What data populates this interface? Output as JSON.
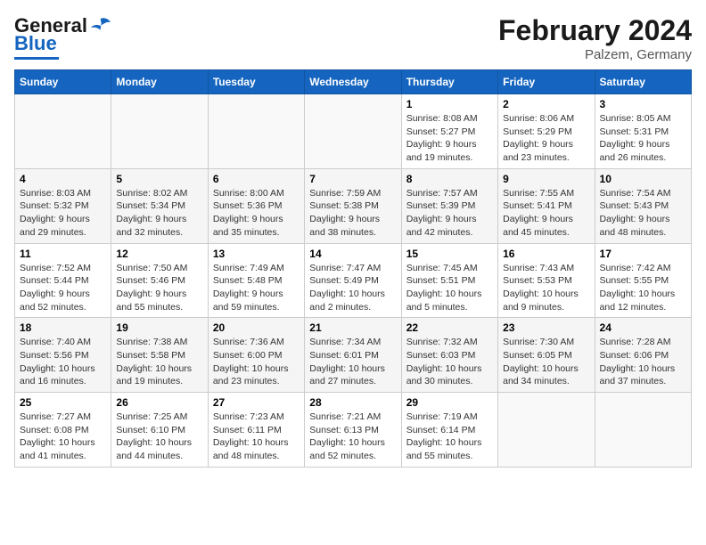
{
  "header": {
    "logo_general": "General",
    "logo_blue": "Blue",
    "month": "February 2024",
    "location": "Palzem, Germany"
  },
  "days_of_week": [
    "Sunday",
    "Monday",
    "Tuesday",
    "Wednesday",
    "Thursday",
    "Friday",
    "Saturday"
  ],
  "weeks": [
    [
      {
        "day": "",
        "info": ""
      },
      {
        "day": "",
        "info": ""
      },
      {
        "day": "",
        "info": ""
      },
      {
        "day": "",
        "info": ""
      },
      {
        "day": "1",
        "info": "Sunrise: 8:08 AM\nSunset: 5:27 PM\nDaylight: 9 hours and 19 minutes."
      },
      {
        "day": "2",
        "info": "Sunrise: 8:06 AM\nSunset: 5:29 PM\nDaylight: 9 hours and 23 minutes."
      },
      {
        "day": "3",
        "info": "Sunrise: 8:05 AM\nSunset: 5:31 PM\nDaylight: 9 hours and 26 minutes."
      }
    ],
    [
      {
        "day": "4",
        "info": "Sunrise: 8:03 AM\nSunset: 5:32 PM\nDaylight: 9 hours and 29 minutes."
      },
      {
        "day": "5",
        "info": "Sunrise: 8:02 AM\nSunset: 5:34 PM\nDaylight: 9 hours and 32 minutes."
      },
      {
        "day": "6",
        "info": "Sunrise: 8:00 AM\nSunset: 5:36 PM\nDaylight: 9 hours and 35 minutes."
      },
      {
        "day": "7",
        "info": "Sunrise: 7:59 AM\nSunset: 5:38 PM\nDaylight: 9 hours and 38 minutes."
      },
      {
        "day": "8",
        "info": "Sunrise: 7:57 AM\nSunset: 5:39 PM\nDaylight: 9 hours and 42 minutes."
      },
      {
        "day": "9",
        "info": "Sunrise: 7:55 AM\nSunset: 5:41 PM\nDaylight: 9 hours and 45 minutes."
      },
      {
        "day": "10",
        "info": "Sunrise: 7:54 AM\nSunset: 5:43 PM\nDaylight: 9 hours and 48 minutes."
      }
    ],
    [
      {
        "day": "11",
        "info": "Sunrise: 7:52 AM\nSunset: 5:44 PM\nDaylight: 9 hours and 52 minutes."
      },
      {
        "day": "12",
        "info": "Sunrise: 7:50 AM\nSunset: 5:46 PM\nDaylight: 9 hours and 55 minutes."
      },
      {
        "day": "13",
        "info": "Sunrise: 7:49 AM\nSunset: 5:48 PM\nDaylight: 9 hours and 59 minutes."
      },
      {
        "day": "14",
        "info": "Sunrise: 7:47 AM\nSunset: 5:49 PM\nDaylight: 10 hours and 2 minutes."
      },
      {
        "day": "15",
        "info": "Sunrise: 7:45 AM\nSunset: 5:51 PM\nDaylight: 10 hours and 5 minutes."
      },
      {
        "day": "16",
        "info": "Sunrise: 7:43 AM\nSunset: 5:53 PM\nDaylight: 10 hours and 9 minutes."
      },
      {
        "day": "17",
        "info": "Sunrise: 7:42 AM\nSunset: 5:55 PM\nDaylight: 10 hours and 12 minutes."
      }
    ],
    [
      {
        "day": "18",
        "info": "Sunrise: 7:40 AM\nSunset: 5:56 PM\nDaylight: 10 hours and 16 minutes."
      },
      {
        "day": "19",
        "info": "Sunrise: 7:38 AM\nSunset: 5:58 PM\nDaylight: 10 hours and 19 minutes."
      },
      {
        "day": "20",
        "info": "Sunrise: 7:36 AM\nSunset: 6:00 PM\nDaylight: 10 hours and 23 minutes."
      },
      {
        "day": "21",
        "info": "Sunrise: 7:34 AM\nSunset: 6:01 PM\nDaylight: 10 hours and 27 minutes."
      },
      {
        "day": "22",
        "info": "Sunrise: 7:32 AM\nSunset: 6:03 PM\nDaylight: 10 hours and 30 minutes."
      },
      {
        "day": "23",
        "info": "Sunrise: 7:30 AM\nSunset: 6:05 PM\nDaylight: 10 hours and 34 minutes."
      },
      {
        "day": "24",
        "info": "Sunrise: 7:28 AM\nSunset: 6:06 PM\nDaylight: 10 hours and 37 minutes."
      }
    ],
    [
      {
        "day": "25",
        "info": "Sunrise: 7:27 AM\nSunset: 6:08 PM\nDaylight: 10 hours and 41 minutes."
      },
      {
        "day": "26",
        "info": "Sunrise: 7:25 AM\nSunset: 6:10 PM\nDaylight: 10 hours and 44 minutes."
      },
      {
        "day": "27",
        "info": "Sunrise: 7:23 AM\nSunset: 6:11 PM\nDaylight: 10 hours and 48 minutes."
      },
      {
        "day": "28",
        "info": "Sunrise: 7:21 AM\nSunset: 6:13 PM\nDaylight: 10 hours and 52 minutes."
      },
      {
        "day": "29",
        "info": "Sunrise: 7:19 AM\nSunset: 6:14 PM\nDaylight: 10 hours and 55 minutes."
      },
      {
        "day": "",
        "info": ""
      },
      {
        "day": "",
        "info": ""
      }
    ]
  ]
}
